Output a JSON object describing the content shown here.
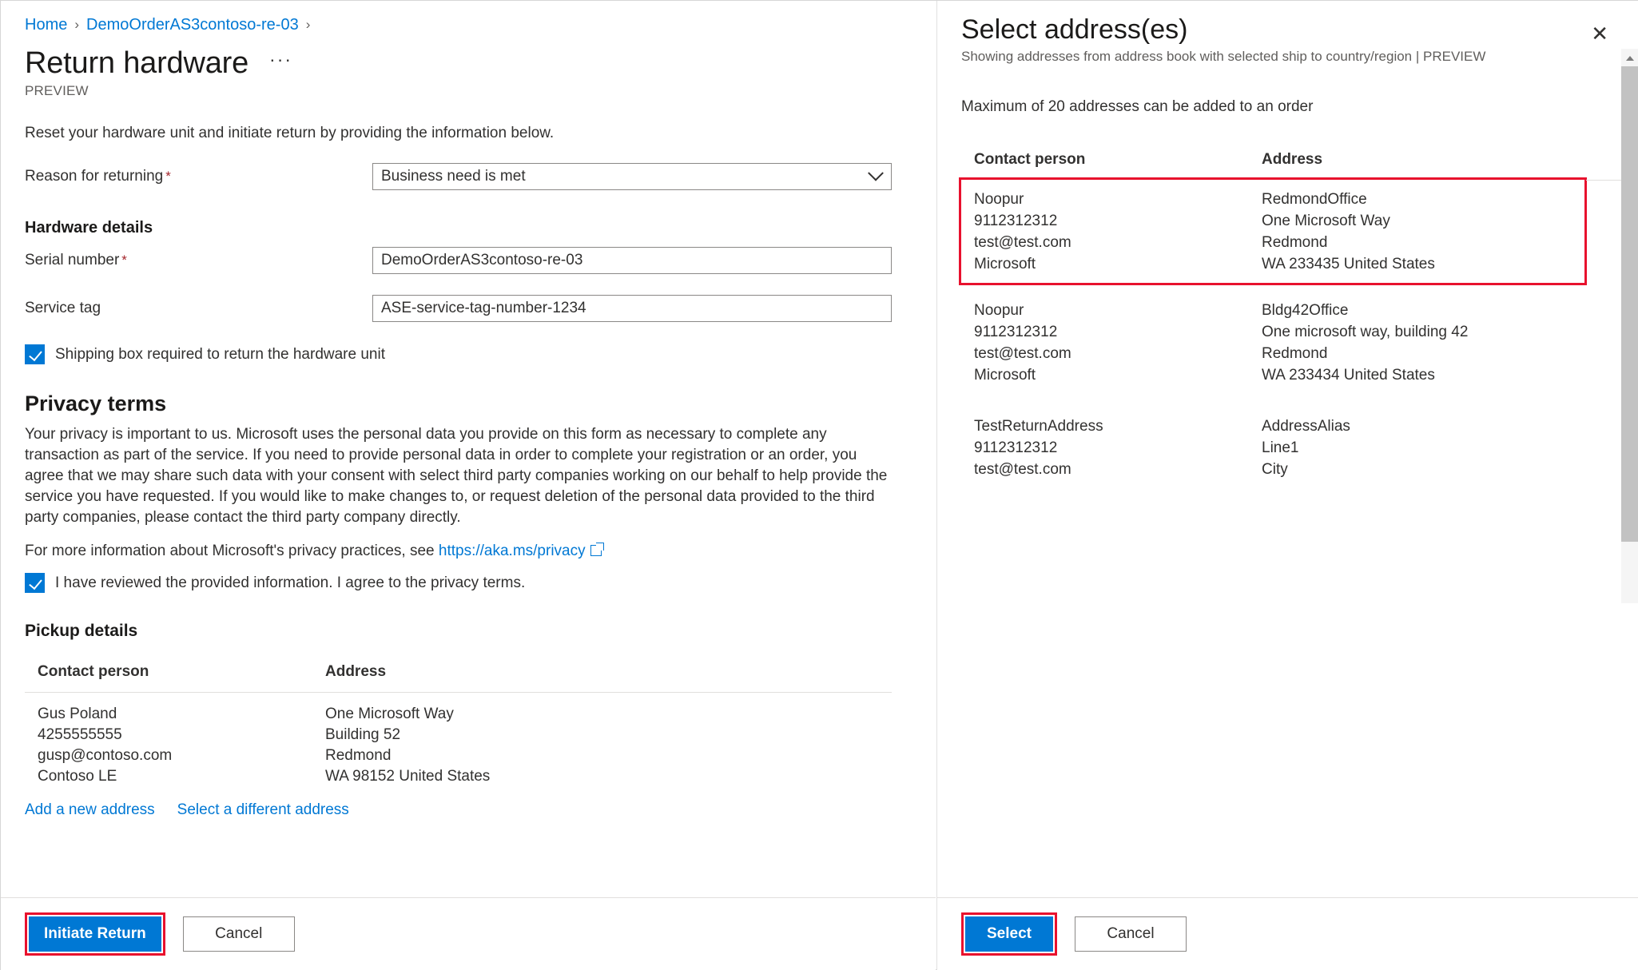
{
  "left": {
    "breadcrumb": {
      "home": "Home",
      "order": "DemoOrderAS3contoso-re-03"
    },
    "page_title": "Return hardware",
    "ellipsis": "···",
    "preview_tag": "PREVIEW",
    "intro": "Reset your hardware unit and initiate return by providing the information below.",
    "reason_label": "Reason for returning",
    "reason_value": "Business need is met",
    "hardware_details_head": "Hardware details",
    "serial_label": "Serial number",
    "serial_value": "DemoOrderAS3contoso-re-03",
    "service_tag_label": "Service tag",
    "service_tag_value": "ASE-service-tag-number-1234",
    "shipping_box_label": "Shipping box required to return the hardware unit",
    "privacy_head": "Privacy terms",
    "privacy_para": "Your privacy is important to us. Microsoft uses the personal data you provide on this form as necessary to complete any transaction as part of the service. If you need to provide personal data in order to complete your registration or an order, you agree that we may share such data with your consent with select third party companies working on our behalf to help provide the service you have requested. If you would like to make changes to, or request deletion of the personal data provided to the third party companies, please contact the third party company directly.",
    "privacy_more_prefix": "For more information about Microsoft's privacy practices, see ",
    "privacy_link": "https://aka.ms/privacy",
    "privacy_consent_label": "I have reviewed the provided information. I agree to the privacy terms.",
    "pickup_head": "Pickup details",
    "table_headers": {
      "contact": "Contact person",
      "address": "Address"
    },
    "pickup_row": {
      "contact": [
        "Gus Poland",
        "4255555555",
        "gusp@contoso.com",
        "Contoso LE"
      ],
      "address": [
        "One Microsoft Way",
        "Building 52",
        "Redmond",
        "WA 98152 United States"
      ]
    },
    "add_address_link": "Add a new address",
    "select_different_link": "Select a different address",
    "initiate_button": "Initiate Return",
    "cancel_button": "Cancel"
  },
  "right": {
    "title": "Select address(es)",
    "subtitle": "Showing addresses from address book with selected ship to country/region | PREVIEW",
    "note": "Maximum of 20 addresses can be added to an order",
    "close_label": "✕",
    "table_headers": {
      "contact": "Contact person",
      "address": "Address"
    },
    "rows": [
      {
        "highlighted": true,
        "contact": [
          "Noopur",
          "9112312312",
          "test@test.com",
          "Microsoft"
        ],
        "address": [
          "RedmondOffice",
          "One Microsoft Way",
          "Redmond",
          "WA 233435 United States"
        ]
      },
      {
        "highlighted": false,
        "contact": [
          "Noopur",
          "9112312312",
          "test@test.com",
          "Microsoft"
        ],
        "address": [
          "Bldg42Office",
          "One microsoft way, building 42",
          "Redmond",
          "WA 233434 United States"
        ]
      },
      {
        "highlighted": false,
        "contact": [
          "TestReturnAddress",
          "9112312312",
          "test@test.com"
        ],
        "address": [
          "AddressAlias",
          "Line1",
          "City"
        ]
      }
    ],
    "select_button": "Select",
    "cancel_button": "Cancel"
  },
  "colors": {
    "accent": "#0078d4",
    "link": "#0078d4",
    "highlight": "#e8112d",
    "required": "#a4262c"
  }
}
